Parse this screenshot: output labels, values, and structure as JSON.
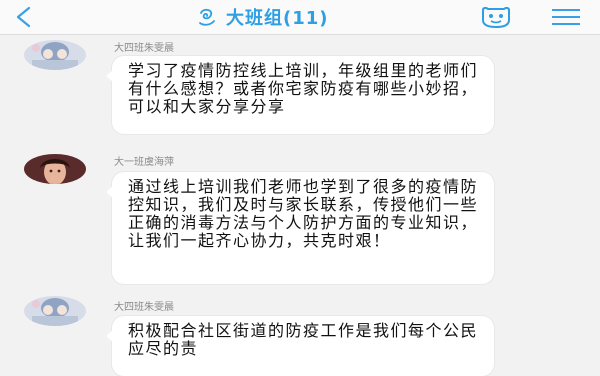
{
  "header": {
    "back_icon": "chevron-left-icon",
    "title": "大班组(11)",
    "title_icon": "swirl-icon",
    "face_icon": "smiley-face-icon",
    "menu_icon": "hamburger-menu-icon",
    "accent_color": "#2f9fe3"
  },
  "messages": [
    {
      "sender": "大四班朱雯晨",
      "text": "学习了疫情防控线上培训，年级组里的老师们有什么感想？或者你宅家防疫有哪些小妙招，可以和大家分享分享"
    },
    {
      "sender": "大一班虞海萍",
      "text": "通过线上培训我们老师也学到了很多的疫情防控知识，我们及时与家长联系，传授他们一些正确的消毒方法与个人防护方面的专业知识，让我们一起齐心协力，共克时艰！"
    },
    {
      "sender": "大四班朱雯晨",
      "text": "积极配合社区街道的防疫工作是我们每个公民应尽的责"
    }
  ]
}
